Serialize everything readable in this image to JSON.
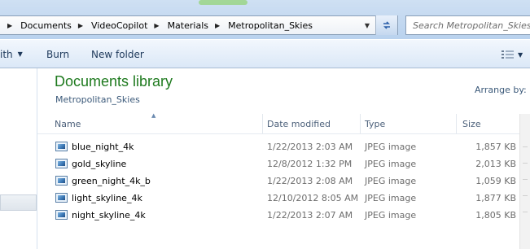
{
  "address_bar": {
    "breadcrumbs": [
      "Documents",
      "VideoCopilot",
      "Materials",
      "Metropolitan_Skies"
    ],
    "search_placeholder": "Search Metropolitan_Skies"
  },
  "toolbar": {
    "first_label": "ith",
    "burn_label": "Burn",
    "new_folder_label": "New folder"
  },
  "library": {
    "title": "Documents library",
    "subtitle": "Metropolitan_Skies",
    "arrange_by_label": "Arrange by:"
  },
  "columns": {
    "name": "Name",
    "date": "Date modified",
    "type": "Type",
    "size": "Size"
  },
  "files": [
    {
      "name": "blue_night_4k",
      "date": "1/22/2013 2:03 AM",
      "type": "JPEG image",
      "size": "1,857 KB"
    },
    {
      "name": "gold_skyline",
      "date": "12/8/2012 1:32 PM",
      "type": "JPEG image",
      "size": "2,013 KB"
    },
    {
      "name": "green_night_4k_b",
      "date": "1/22/2013 2:08 AM",
      "type": "JPEG image",
      "size": "1,059 KB"
    },
    {
      "name": "light_skyline_4k",
      "date": "12/10/2012 8:05 AM",
      "type": "JPEG image",
      "size": "1,877 KB"
    },
    {
      "name": "night_skyline_4k",
      "date": "1/22/2013 2:07 AM",
      "type": "JPEG image",
      "size": "1,805 KB"
    }
  ],
  "icons": {
    "file": "jpeg-file-icon",
    "refresh": "refresh-icon",
    "view": "view-options-icon"
  }
}
